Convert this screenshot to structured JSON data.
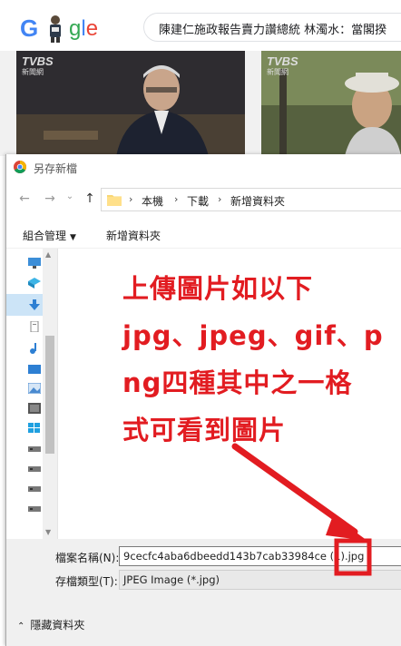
{
  "browser": {
    "logo": {
      "g": "G",
      "rest_1": "g",
      "rest_2": "l",
      "rest_3": "e"
    },
    "search_text": "陳建仁施政報告賣力讚總統 林濁水：當閣揆",
    "news_images": [
      {
        "watermark": "TVBS",
        "sub": "新聞網"
      },
      {
        "watermark": "TVBS",
        "sub": "新聞網"
      }
    ]
  },
  "dialog": {
    "title": "另存新檔",
    "nav": {
      "back": "←",
      "forward": "→",
      "recent": "⌄",
      "up": "↑"
    },
    "breadcrumb": [
      "本機",
      "下載",
      "新增資料夾"
    ],
    "toolbar": {
      "organize": "組合管理",
      "new_folder": "新增資料夾"
    },
    "annotation_lines": [
      "上傳圖片如以下",
      "jpg、jpeg、gif、p",
      "ng四種其中之一格",
      "式可看到圖片"
    ],
    "filename_label": "檔案名稱(N):",
    "filename_value": "9cecfc4aba6dbeedd143b7cab33984ce (1).jpg",
    "filetype_label": "存檔類型(T):",
    "filetype_value": "JPEG Image (*.jpg)",
    "hide_folders": "隱藏資料夾"
  },
  "colors": {
    "annotation": "#e21c21",
    "selected": "#cce4f7"
  }
}
